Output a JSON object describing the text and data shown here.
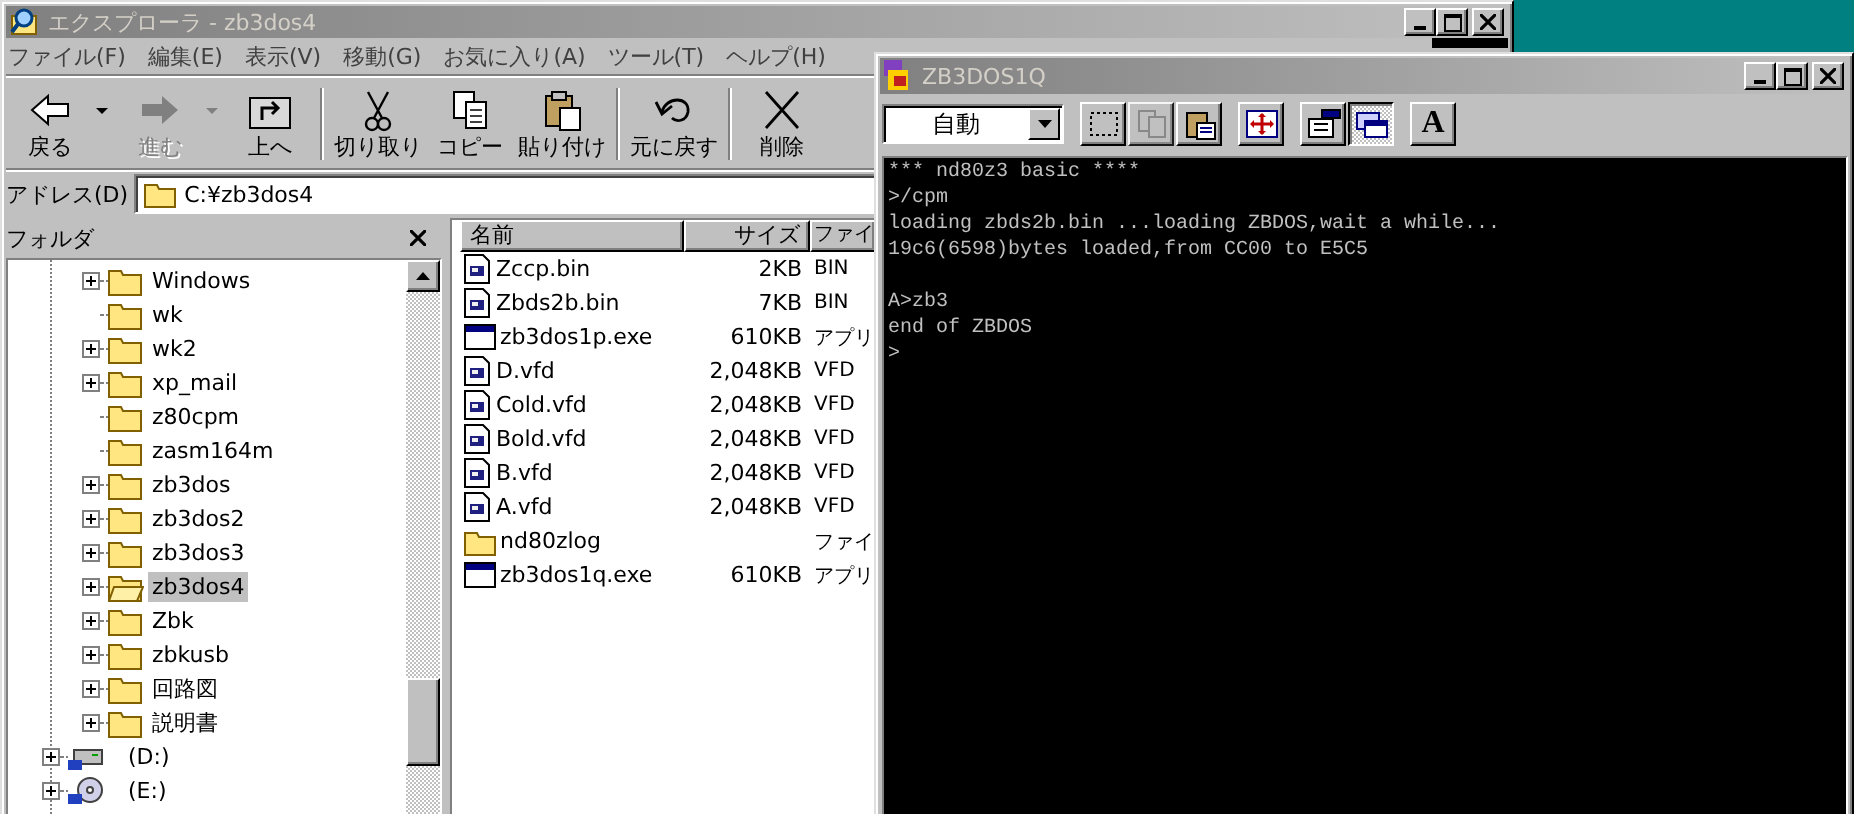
{
  "explorer": {
    "title": "エクスプローラ - zb3dos4",
    "menu": [
      "ファイル(F)",
      "編集(E)",
      "表示(V)",
      "移動(G)",
      "お気に入り(A)",
      "ツール(T)",
      "ヘルプ(H)"
    ],
    "toolbar": [
      {
        "kind": "back",
        "label": "戻る",
        "disabled": false,
        "dropdown": true
      },
      {
        "kind": "forward",
        "label": "進む",
        "disabled": true,
        "dropdown": true
      },
      {
        "kind": "up",
        "label": "上へ",
        "disabled": false,
        "dropdown": false
      },
      {
        "kind": "separator"
      },
      {
        "kind": "cut",
        "label": "切り取り",
        "disabled": false,
        "dropdown": false
      },
      {
        "kind": "copy",
        "label": "コピー",
        "disabled": false,
        "dropdown": false
      },
      {
        "kind": "paste",
        "label": "貼り付け",
        "disabled": false,
        "dropdown": false
      },
      {
        "kind": "separator"
      },
      {
        "kind": "undo",
        "label": "元に戻す",
        "disabled": false,
        "dropdown": false
      },
      {
        "kind": "separator"
      },
      {
        "kind": "delete",
        "label": "削除",
        "disabled": false,
        "dropdown": false
      }
    ],
    "address": {
      "label": "アドレス(D)",
      "value": "C:¥zb3dos4"
    },
    "folder_pane": {
      "title": "フォルダ",
      "tree": [
        {
          "children": [
            {
              "label": "Windows",
              "kind": "folder",
              "expandable": true,
              "selected": false
            },
            {
              "label": "wk",
              "kind": "folder",
              "expandable": false,
              "selected": false
            },
            {
              "label": "wk2",
              "kind": "folder",
              "expandable": true,
              "selected": false
            },
            {
              "label": "xp_mail",
              "kind": "folder",
              "expandable": true,
              "selected": false
            },
            {
              "label": "z80cpm",
              "kind": "folder",
              "expandable": false,
              "selected": false
            },
            {
              "label": "zasm164m",
              "kind": "folder",
              "expandable": false,
              "selected": false
            },
            {
              "label": "zb3dos",
              "kind": "folder",
              "expandable": true,
              "selected": false
            },
            {
              "label": "zb3dos2",
              "kind": "folder",
              "expandable": true,
              "selected": false
            },
            {
              "label": "zb3dos3",
              "kind": "folder",
              "expandable": true,
              "selected": false
            },
            {
              "label": "zb3dos4",
              "kind": "folder",
              "expandable": true,
              "selected": true
            },
            {
              "label": "Zbk",
              "kind": "folder",
              "expandable": true,
              "selected": false
            },
            {
              "label": "zbkusb",
              "kind": "folder",
              "expandable": true,
              "selected": false
            },
            {
              "label": "回路図",
              "kind": "folder",
              "expandable": true,
              "selected": false
            },
            {
              "label": "説明書",
              "kind": "folder",
              "expandable": true,
              "selected": false
            }
          ]
        },
        {
          "label": "(D:)",
          "kind": "drive",
          "expandable": true,
          "selected": false
        },
        {
          "label": "(E:)",
          "kind": "cdrom",
          "expandable": true,
          "selected": false
        }
      ]
    },
    "file_list": {
      "columns": [
        "名前",
        "サイズ",
        "ファイ"
      ],
      "rows": [
        {
          "kind": "file",
          "name": "Zccp.bin",
          "size": "2KB",
          "type": "BIN"
        },
        {
          "kind": "file",
          "name": "Zbds2b.bin",
          "size": "7KB",
          "type": "BIN"
        },
        {
          "kind": "exe",
          "name": "zb3dos1p.exe",
          "size": "610KB",
          "type": "アプリ"
        },
        {
          "kind": "file",
          "name": "D.vfd",
          "size": "2,048KB",
          "type": "VFD"
        },
        {
          "kind": "file",
          "name": "Cold.vfd",
          "size": "2,048KB",
          "type": "VFD"
        },
        {
          "kind": "file",
          "name": "Bold.vfd",
          "size": "2,048KB",
          "type": "VFD"
        },
        {
          "kind": "file",
          "name": "B.vfd",
          "size": "2,048KB",
          "type": "VFD"
        },
        {
          "kind": "file",
          "name": "A.vfd",
          "size": "2,048KB",
          "type": "VFD"
        },
        {
          "kind": "folder",
          "name": "nd80zlog",
          "type": "ファイ"
        },
        {
          "kind": "exe",
          "name": "zb3dos1q.exe",
          "size": "610KB",
          "type": "アプリ"
        }
      ]
    }
  },
  "console": {
    "title": "ZB3DOS1Q",
    "font_size": "自動",
    "buttons": [
      {
        "kind": "mark",
        "disabled": false,
        "pressed": false
      },
      {
        "kind": "copy",
        "disabled": true,
        "pressed": false
      },
      {
        "kind": "paste",
        "disabled": false,
        "pressed": false
      },
      {
        "kind": "fullscreen",
        "disabled": false,
        "pressed": false
      },
      {
        "kind": "properties",
        "disabled": false,
        "pressed": false
      },
      {
        "kind": "background",
        "disabled": false,
        "pressed": true
      },
      {
        "kind": "font",
        "label": "A",
        "disabled": false,
        "pressed": false
      }
    ],
    "output": [
      [
        "*** nd80z3 basic ****",
        ">/cpm",
        "loading zbds2b.bin ...loading ZBDOS,wait a while...",
        "19c6(6598)bytes loaded,from CC00 to E5C5"
      ],
      [
        "A>zb3",
        "end of ZBDOS",
        ">"
      ]
    ]
  }
}
